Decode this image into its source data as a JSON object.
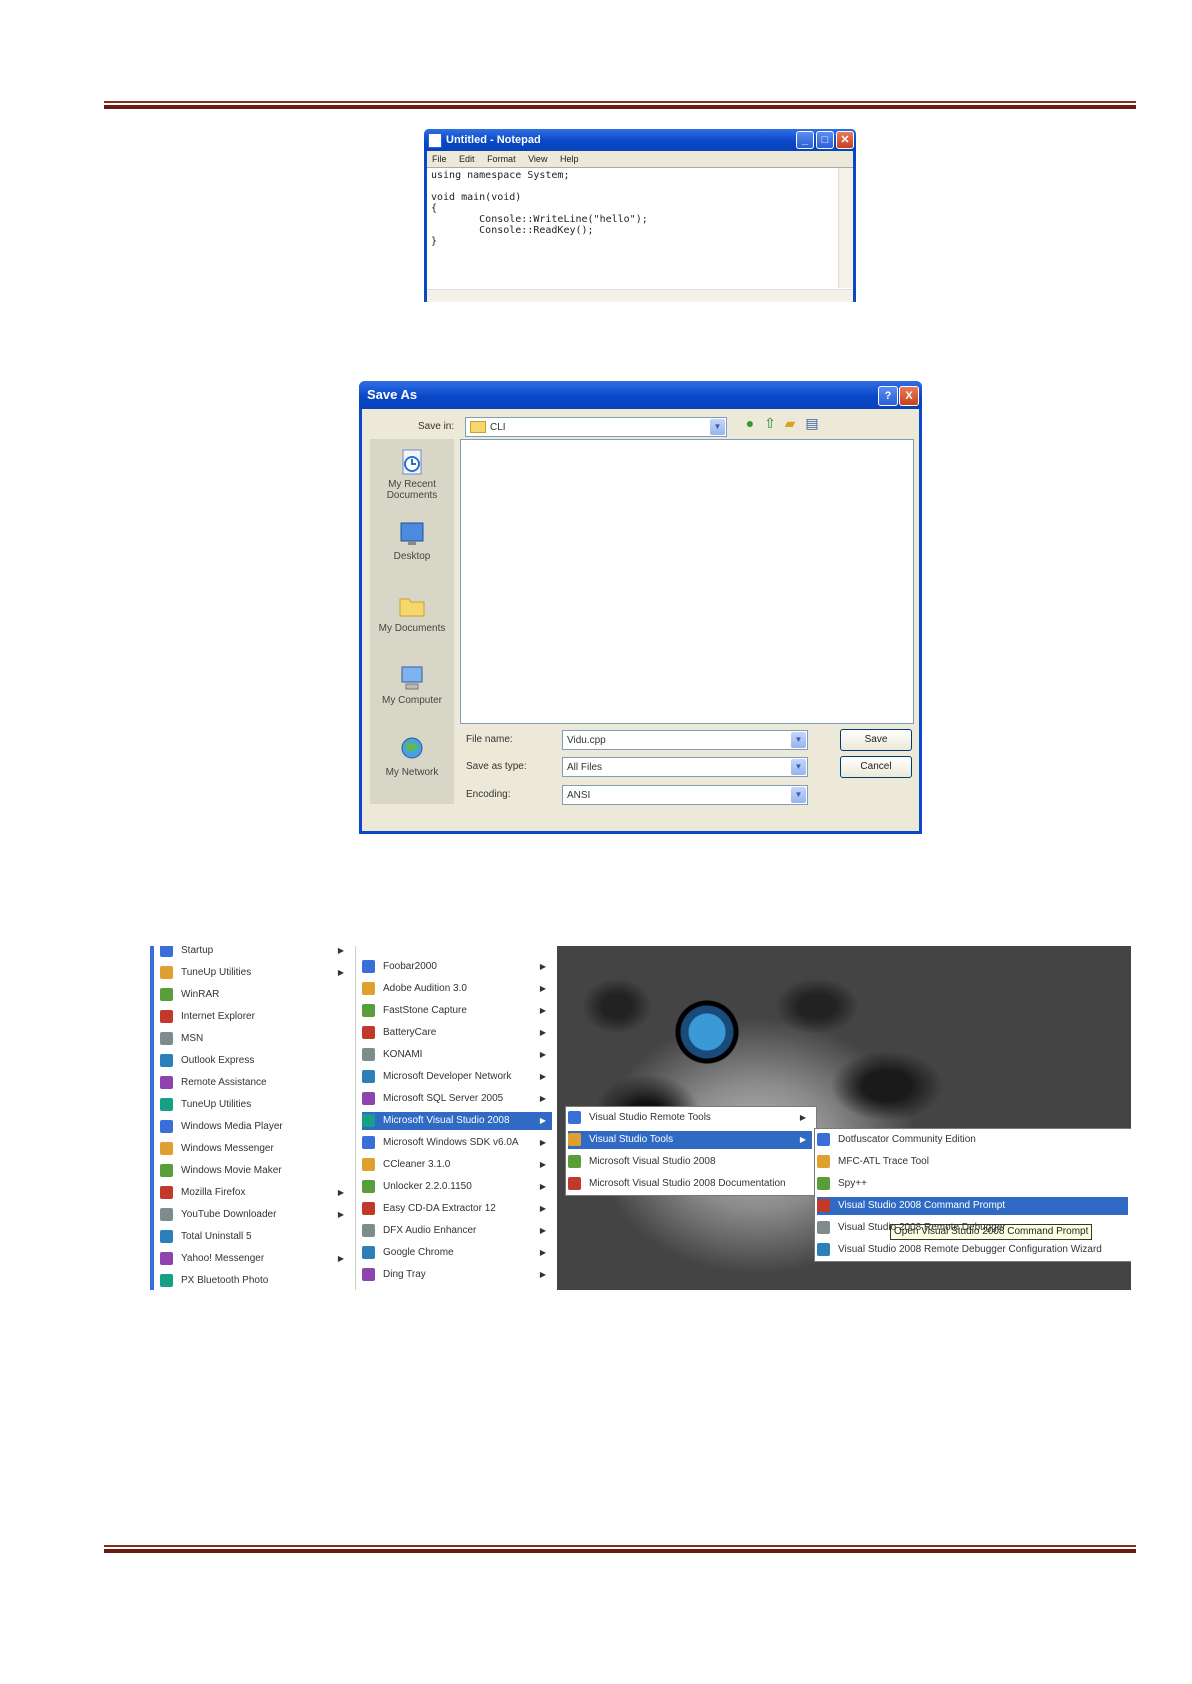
{
  "notepad": {
    "title": "Untitled - Notepad",
    "menu": [
      "File",
      "Edit",
      "Format",
      "View",
      "Help"
    ],
    "code": "using namespace System;\n\nvoid main(void)\n{\n        Console::WriteLine(\"hello\");\n        Console::ReadKey();\n}"
  },
  "saveas": {
    "title": "Save As",
    "save_in_label": "Save in:",
    "save_in_value": "CLI",
    "places": [
      "My Recent Documents",
      "Desktop",
      "My Documents",
      "My Computer",
      "My Network"
    ],
    "file_name_label": "File name:",
    "file_name_value": "Vidu.cpp",
    "save_as_type_label": "Save as type:",
    "save_as_type_value": "All Files",
    "encoding_label": "Encoding:",
    "encoding_value": "ANSI",
    "save_button": "Save",
    "cancel_button": "Cancel",
    "help_button": "?",
    "close_button": "X"
  },
  "startmenu": {
    "col1": [
      "Startup",
      "TuneUp Utilities",
      "WinRAR",
      "Internet Explorer",
      "MSN",
      "Outlook Express",
      "Remote Assistance",
      "TuneUp Utilities",
      "Windows Media Player",
      "Windows Messenger",
      "Windows Movie Maker",
      "Mozilla Firefox",
      "YouTube Downloader",
      "Total Uninstall 5",
      "Yahoo! Messenger",
      "PX Bluetooth Photo"
    ],
    "col1_arrows": [
      true,
      true,
      false,
      false,
      false,
      false,
      false,
      false,
      false,
      false,
      false,
      true,
      true,
      false,
      true,
      false
    ],
    "col2": [
      "Foobar2000",
      "Adobe Audition 3.0",
      "FastStone Capture",
      "BatteryCare",
      "KONAMI",
      "Microsoft Developer Network",
      "Microsoft SQL Server 2005",
      "Microsoft Visual Studio 2008",
      "Microsoft Windows SDK v6.0A",
      "CCleaner 3.1.0",
      "Unlocker 2.2.0.1150",
      "Easy CD-DA Extractor 12",
      "DFX Audio Enhancer",
      "Google Chrome",
      "Ding Tray"
    ],
    "col2_highlight": 7,
    "sub3": [
      "Visual Studio Remote Tools",
      "Visual Studio Tools",
      "Microsoft Visual Studio 2008",
      "Microsoft Visual Studio 2008 Documentation"
    ],
    "sub3_highlight": 1,
    "sub4": [
      "Dotfuscator Community Edition",
      "MFC-ATL Trace Tool",
      "Spy++",
      "Visual Studio 2008 Command Prompt",
      "Visual Studio 2008 Remote Debugger",
      "Visual Studio 2008 Remote Debugger Configuration Wizard"
    ],
    "sub4_highlight": 3,
    "tooltip": "Open Visual Studio 2008 Command Prompt"
  }
}
